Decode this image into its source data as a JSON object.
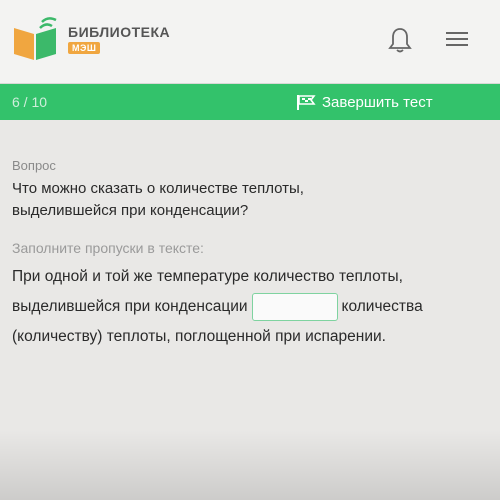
{
  "header": {
    "logo_title": "БИБЛИОТЕКА",
    "logo_badge": "МЭШ",
    "bell_icon": "bell-icon",
    "menu_icon": "hamburger-menu-icon"
  },
  "progress": {
    "counter": "6 / 10",
    "finish_label": "Завершить тест",
    "finish_icon": "flag-icon"
  },
  "question": {
    "label": "Вопрос",
    "text_line1": "Что можно сказать о количестве теплоты,",
    "text_line2": "выделившейся при конденсации?",
    "hint": "Заполните пропуски в тексте:",
    "fill_part1": "При одной и той же температуре количество теплоты, выделившейся при конденсации",
    "fill_blank_value": "",
    "fill_part2": "количества (количеству) теплоты, поглощенной при испарении."
  },
  "colors": {
    "accent_green": "#33c26b",
    "logo_orange": "#f0a640",
    "logo_green": "#3cb96a"
  }
}
